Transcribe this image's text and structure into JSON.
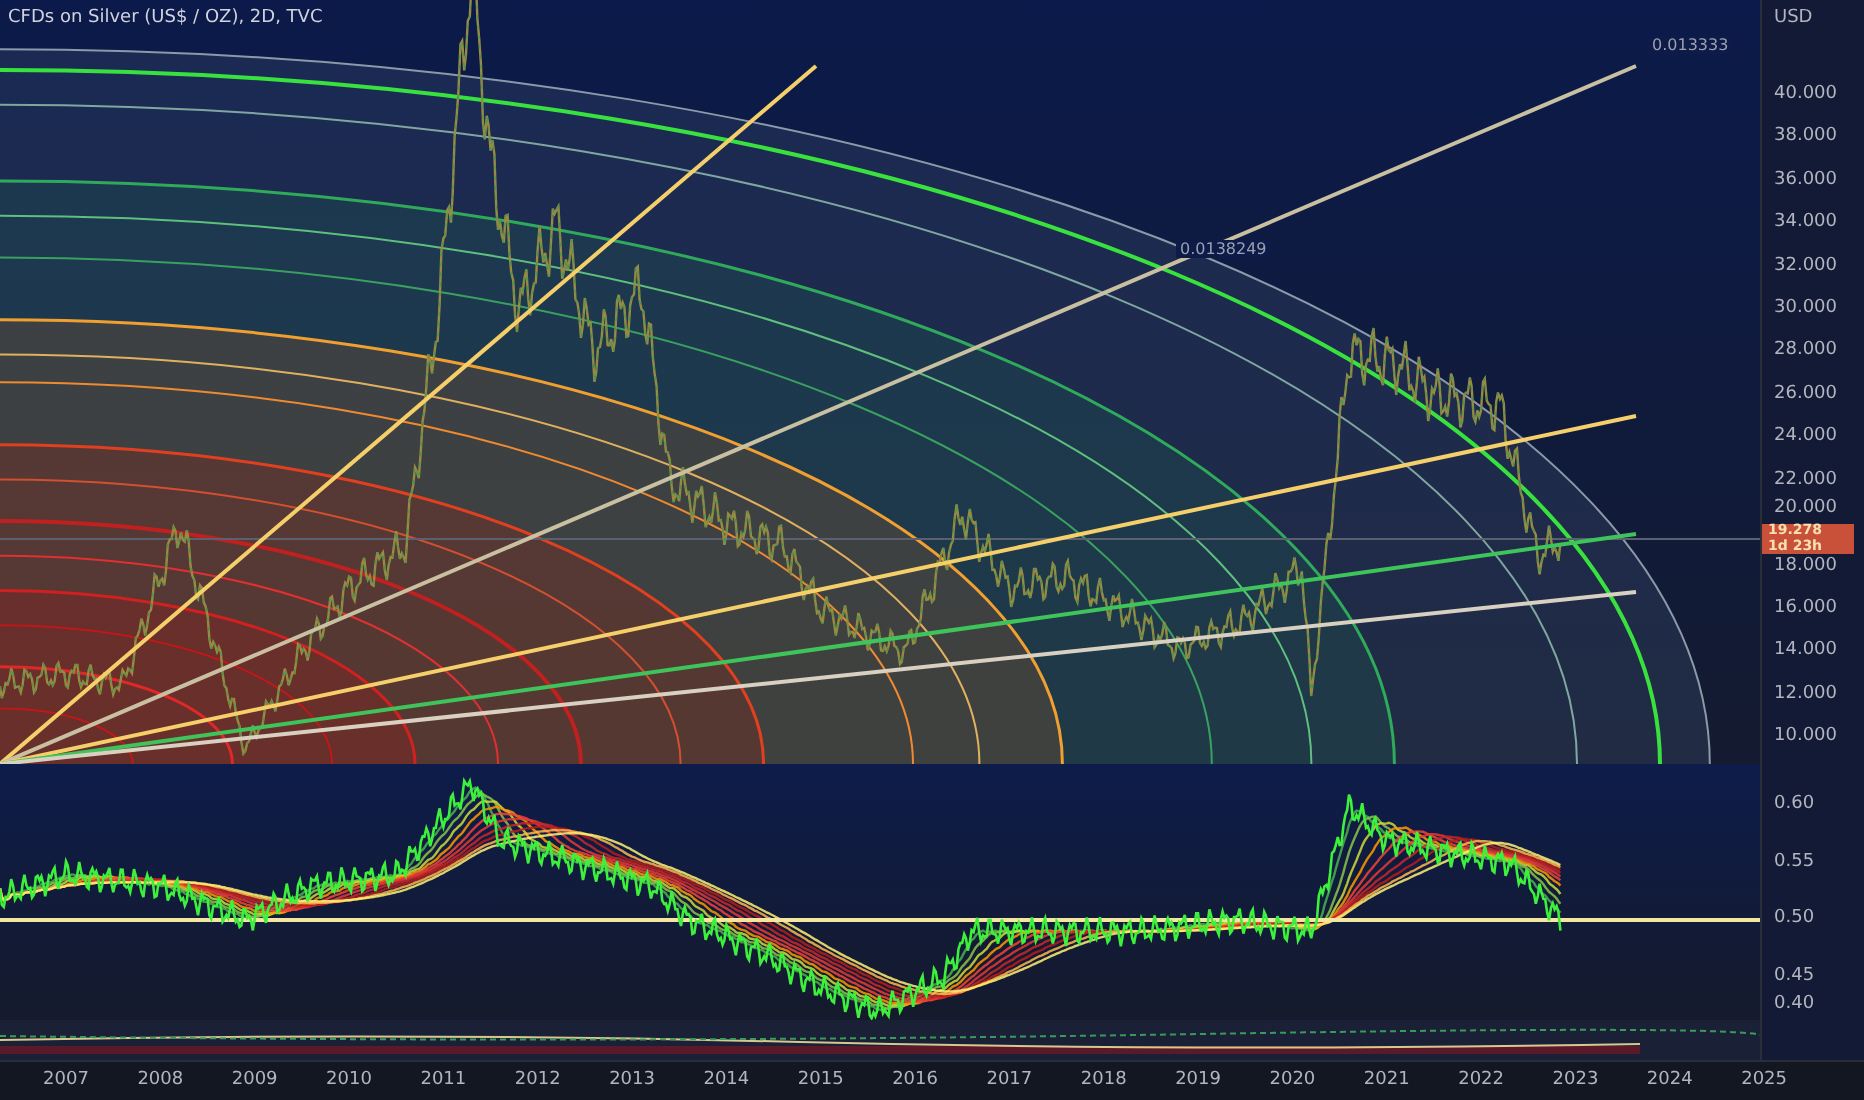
{
  "chart": {
    "title": "CFDs on Silver (US$ / OZ), 2D, TVC",
    "currency": "USD",
    "price_ticks": [
      "40.000",
      "38.000",
      "36.000",
      "34.000",
      "32.000",
      "30.000",
      "28.000",
      "26.000",
      "24.000",
      "22.000",
      "20.000",
      "18.000",
      "16.000",
      "14.000",
      "12.000",
      "10.000"
    ],
    "current_price": {
      "price": "19.278",
      "countdown": "1d 23h"
    },
    "fan_labels": [
      "0.0138249",
      "0.013333"
    ]
  },
  "oscillator": {
    "ticks": [
      "0.60",
      "0.55",
      "0.50",
      "0.45",
      "0.40"
    ]
  },
  "time_axis": {
    "years": [
      "2007",
      "2008",
      "2009",
      "2010",
      "2011",
      "2012",
      "2013",
      "2014",
      "2015",
      "2016",
      "2017",
      "2018",
      "2019",
      "2020",
      "2021",
      "2022",
      "2023",
      "2024",
      "2025"
    ]
  }
}
